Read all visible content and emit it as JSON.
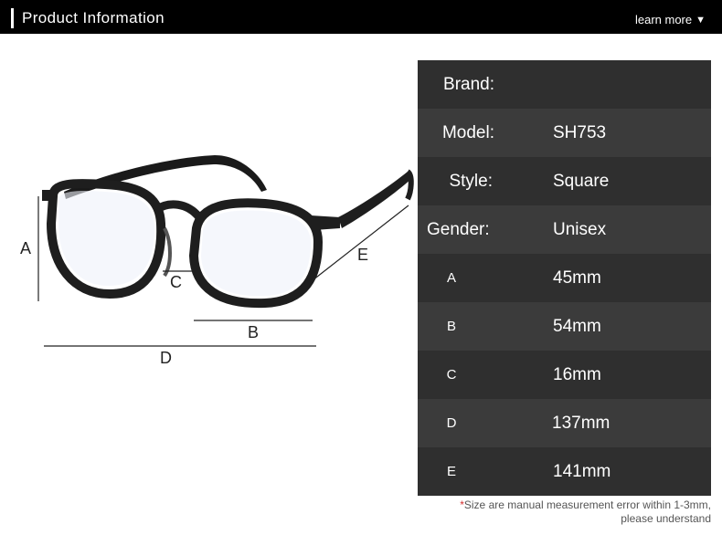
{
  "header": {
    "title": "Product Information",
    "learn_more": "learn more",
    "arrow_icon": "triangle-down-icon"
  },
  "diagram": {
    "labels": {
      "A": "A",
      "B": "B",
      "C": "C",
      "D": "D",
      "E": "E"
    }
  },
  "specs": [
    {
      "key": "Brand:",
      "value": ""
    },
    {
      "key": "Model:",
      "value": "SH753"
    },
    {
      "key": "Style:",
      "value": "Square"
    },
    {
      "key": "Gender:",
      "value": "Unisex"
    },
    {
      "key": "A",
      "value": "45mm"
    },
    {
      "key": "B",
      "value": "54mm"
    },
    {
      "key": "C",
      "value": "16mm"
    },
    {
      "key": "D",
      "value": "137mm"
    },
    {
      "key": "E",
      "value": "141mm"
    }
  ],
  "note": {
    "star": "*",
    "line1": "Size are manual measurement error within 1-3mm,",
    "line2": "please understand"
  }
}
